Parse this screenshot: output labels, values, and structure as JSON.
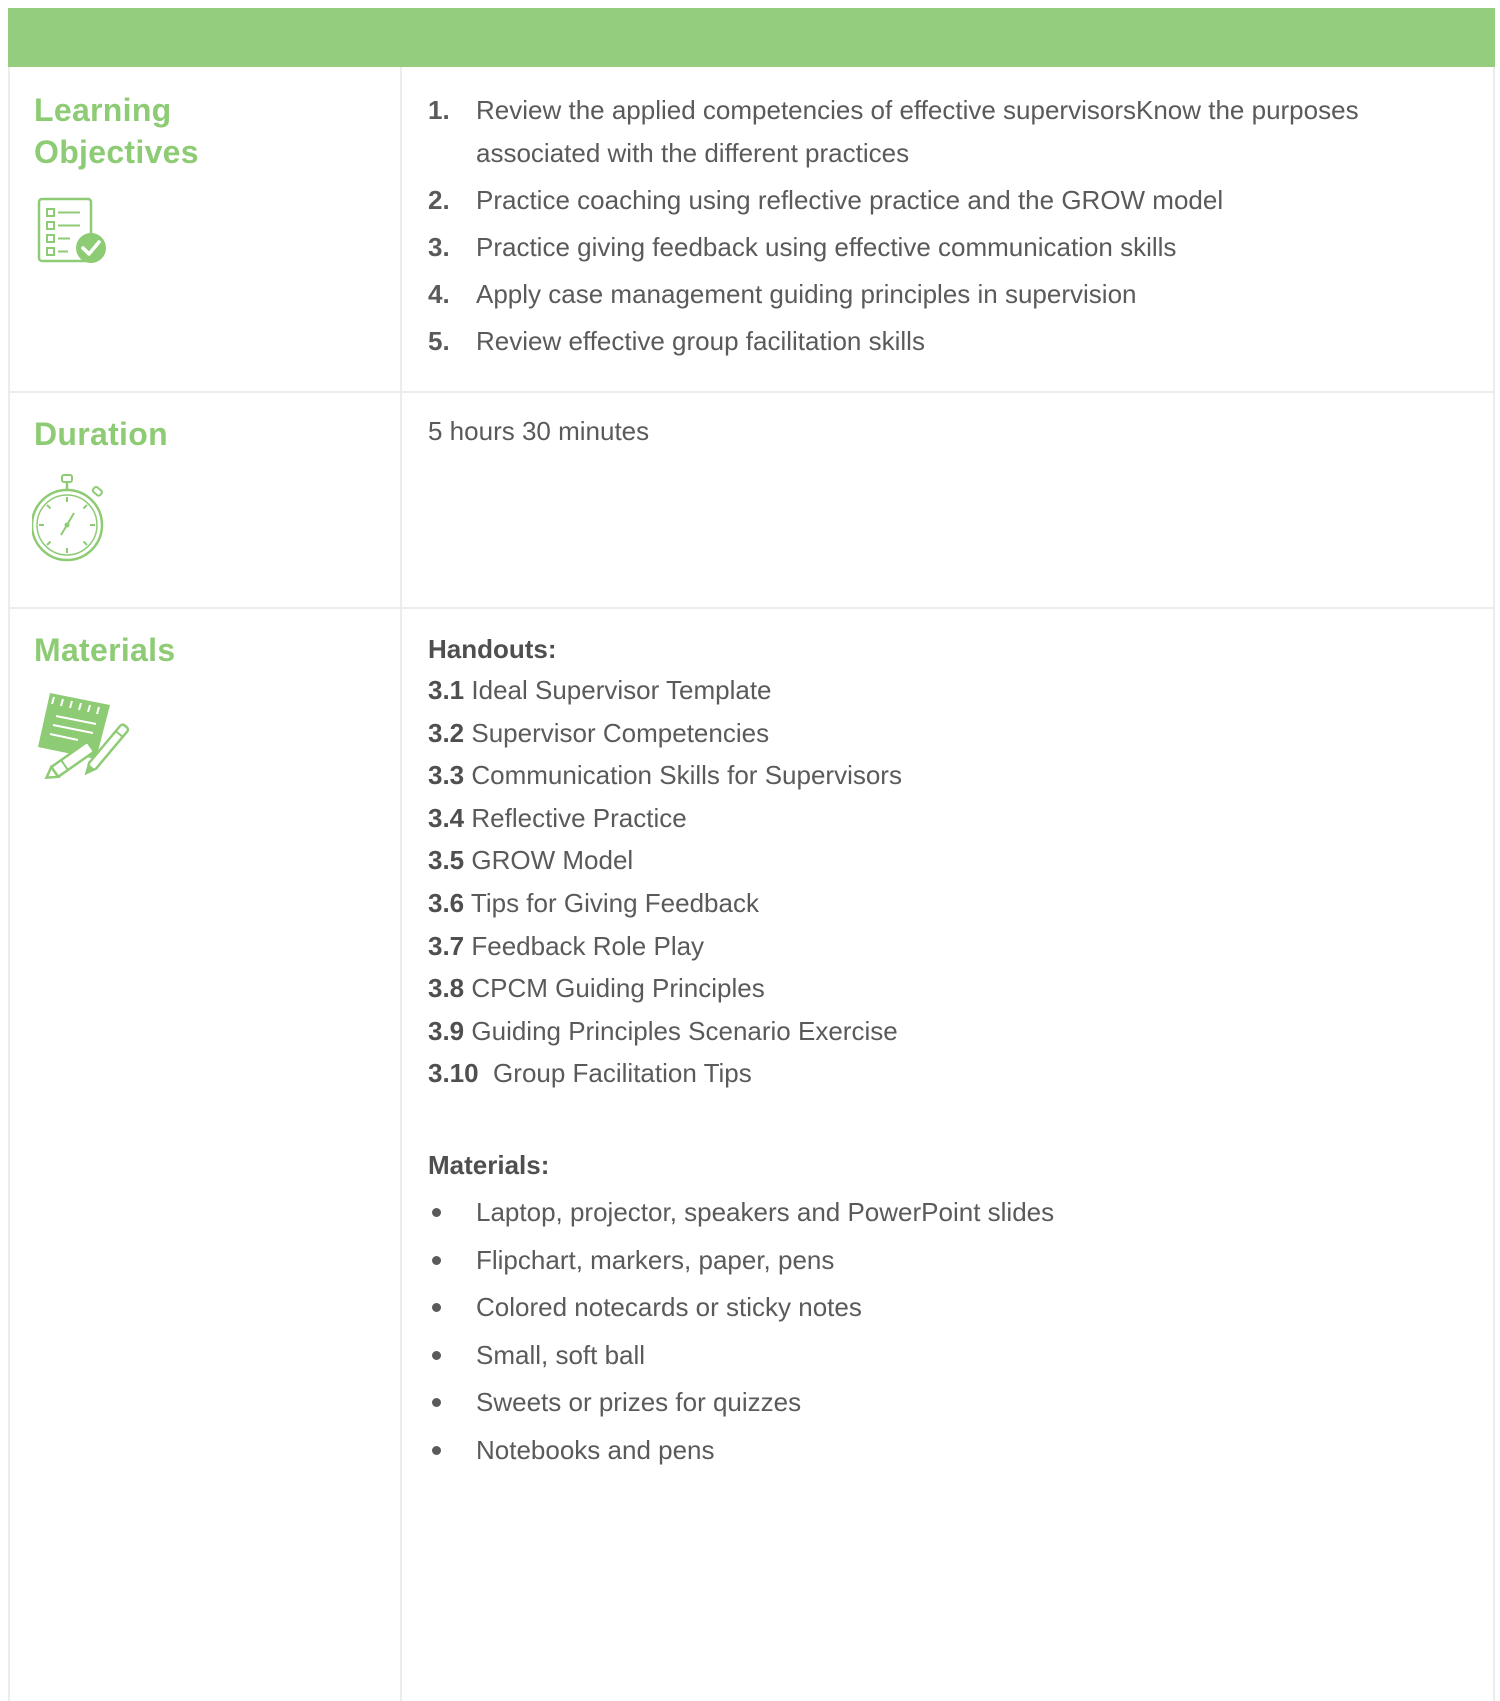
{
  "sections": {
    "objectives": {
      "title": "Learning Objectives",
      "icon": "checklist-icon",
      "items": [
        {
          "num": "1.",
          "text": "Review the applied competencies of effective supervisorsKnow the purposes associated with the different practices"
        },
        {
          "num": "2.",
          "text": "Practice coaching using reflective practice and the GROW model"
        },
        {
          "num": "3.",
          "text": "Practice giving feedback using effective communication skills"
        },
        {
          "num": "4.",
          "text": "Apply case management guiding principles in supervision"
        },
        {
          "num": "5.",
          "text": "Review effective group facilitation skills"
        }
      ]
    },
    "duration": {
      "title": "Duration",
      "icon": "stopwatch-icon",
      "value": "5 hours 30 minutes"
    },
    "materials": {
      "title": "Materials",
      "icon": "notepad-pencil-icon",
      "handouts_heading": "Handouts:",
      "handouts": [
        {
          "num": "3.1",
          "text": " Ideal Supervisor Template"
        },
        {
          "num": "3.2",
          "text": " Supervisor Competencies"
        },
        {
          "num": "3.3",
          "text": " Communication Skills for Supervisors"
        },
        {
          "num": "3.4",
          "text": " Reflective Practice"
        },
        {
          "num": "3.5",
          "text": " GROW Model"
        },
        {
          "num": "3.6",
          "text": " Tips for Giving Feedback"
        },
        {
          "num": "3.7",
          "text": " Feedback Role Play"
        },
        {
          "num": "3.8",
          "text": " CPCM Guiding Principles"
        },
        {
          "num": "3.9",
          "text": " Guiding Principles Scenario Exercise"
        },
        {
          "num": "3.10",
          "text": "  Group Facilitation Tips"
        }
      ],
      "materials_heading": "Materials:",
      "items": [
        "Laptop, projector, speakers and PowerPoint slides",
        "Flipchart, markers, paper, pens",
        "Colored notecards or sticky notes",
        "Small, soft ball",
        "Sweets or prizes for quizzes",
        "Notebooks and pens"
      ]
    }
  },
  "colors": {
    "header_bar": "#95cd7e",
    "accent_title": "#8ecb75",
    "body_text": "#5a5a5a",
    "border": "#ececec"
  }
}
